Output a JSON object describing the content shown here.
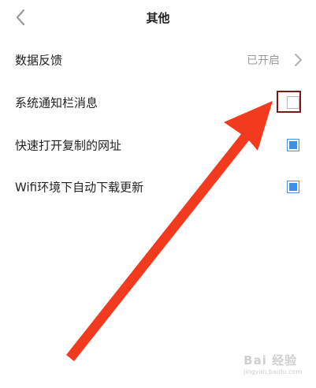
{
  "header": {
    "title": "其他",
    "back_icon": "chevron-left-icon"
  },
  "rows": [
    {
      "label": "数据反馈",
      "value": "已开启",
      "control": "chevron-right-icon"
    },
    {
      "label": "系统通知栏消息",
      "checked": false
    },
    {
      "label": "快速打开复制的网址",
      "checked": true
    },
    {
      "label": "Wifi环境下自动下载更新",
      "checked": true
    }
  ],
  "annotation": {
    "arrow_color": "#f23a1e",
    "highlight_color": "#7a1a14"
  },
  "watermark": {
    "text": "Bai 经验",
    "sub": "jingyan.baidu.com"
  },
  "colors": {
    "checkbox_on": "#3d8ff0",
    "secondary_text": "#9a9a9a"
  }
}
